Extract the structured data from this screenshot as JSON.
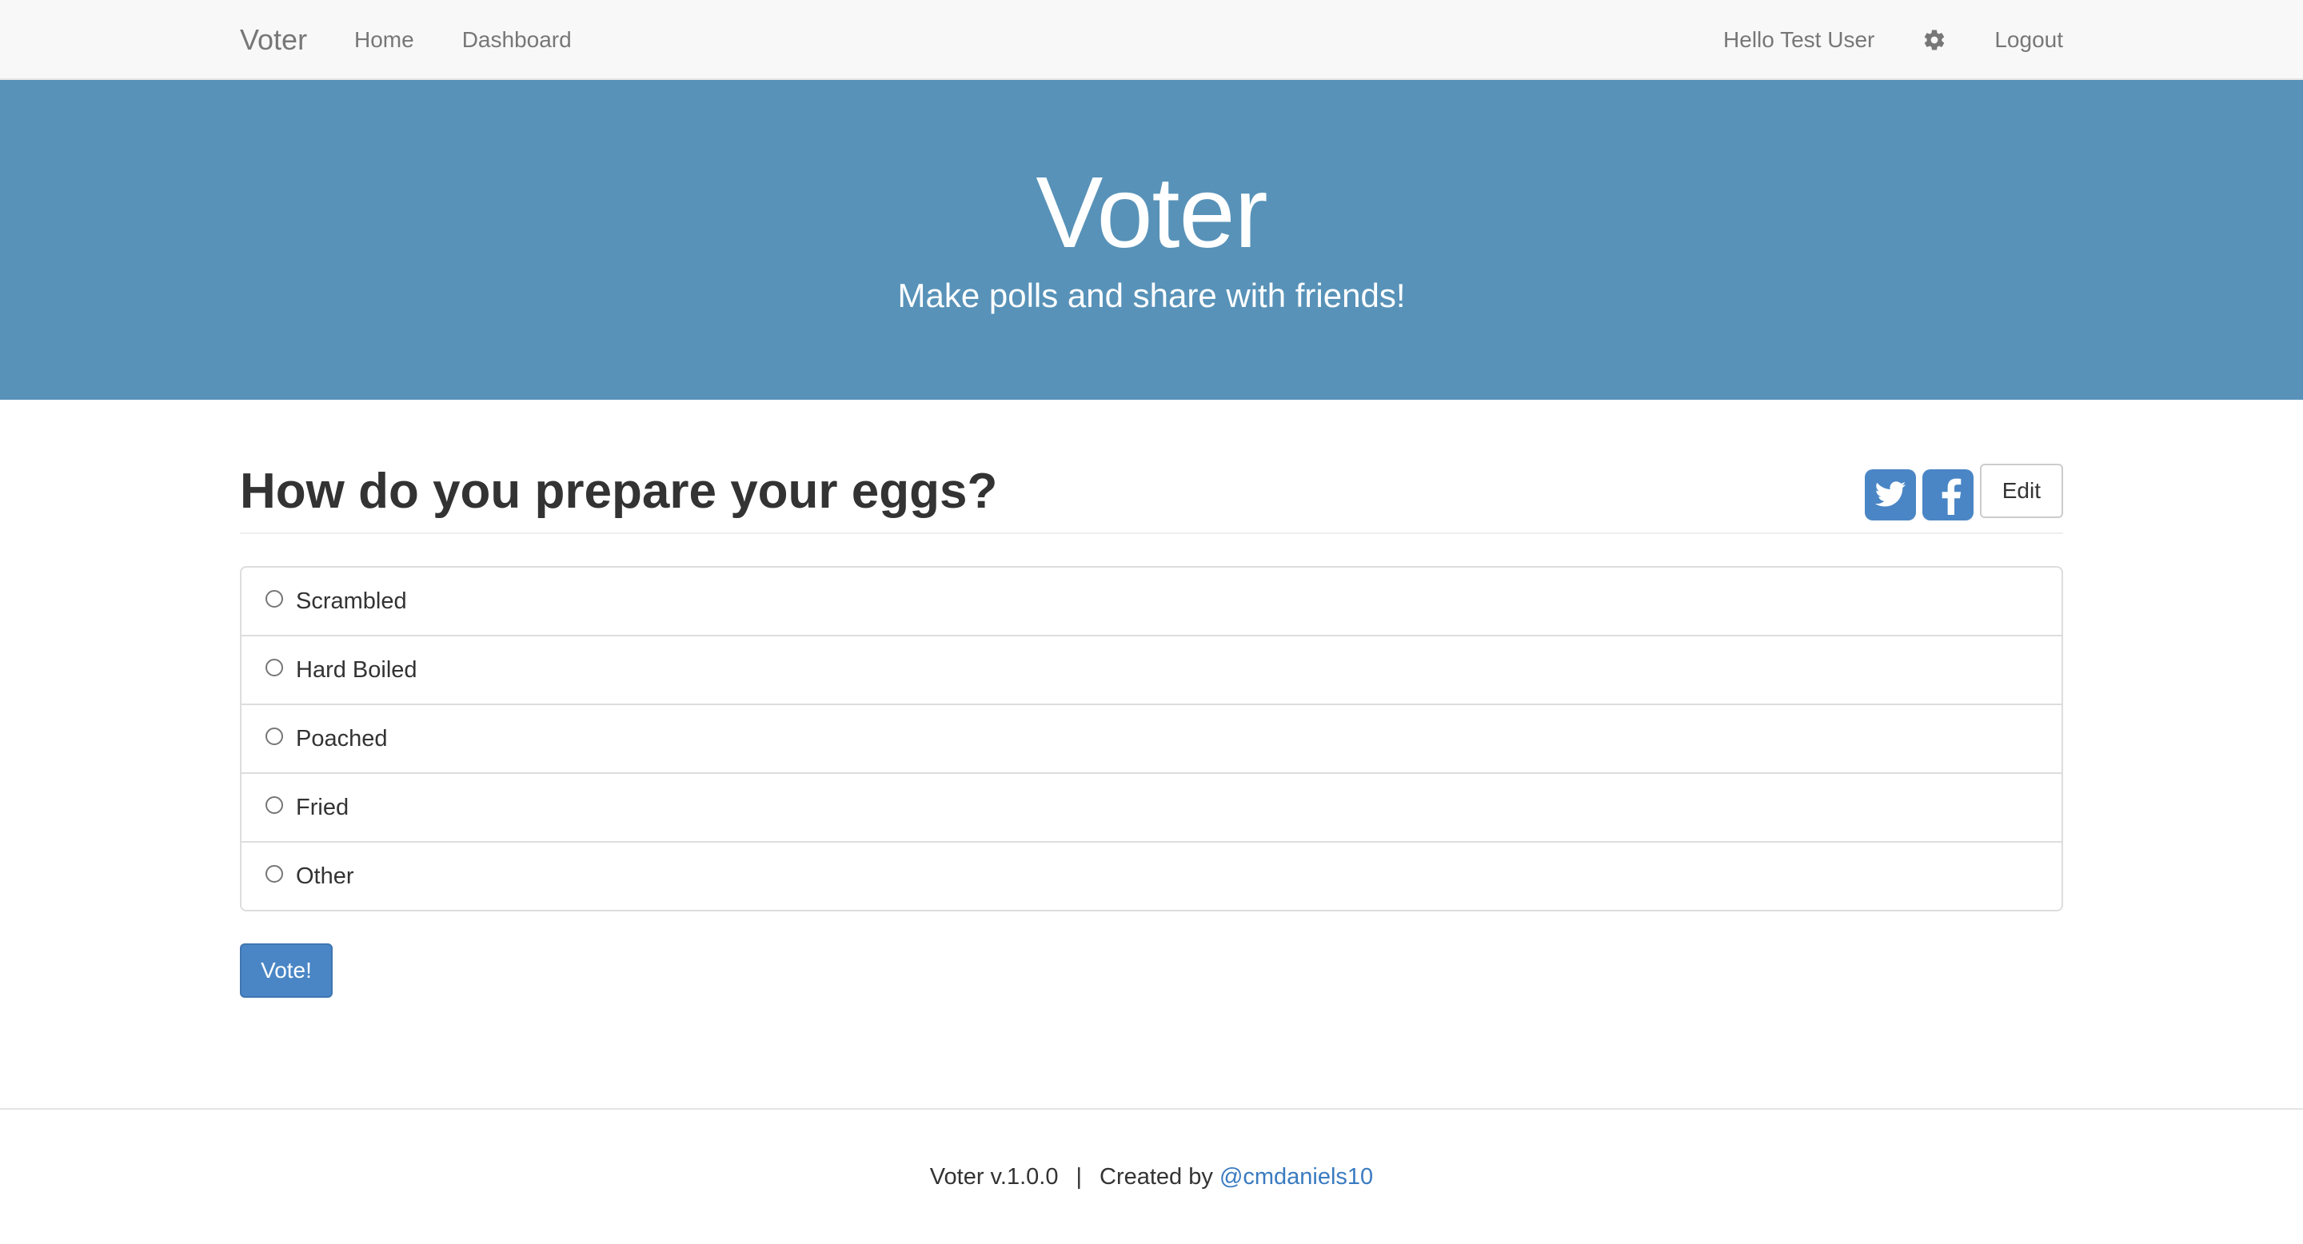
{
  "navbar": {
    "brand": "Voter",
    "links": [
      "Home",
      "Dashboard"
    ],
    "greeting": "Hello Test User",
    "settings_icon": "gear-icon",
    "logout": "Logout"
  },
  "jumbotron": {
    "title": "Voter",
    "subtitle": "Make polls and share with friends!"
  },
  "poll": {
    "question": "How do you prepare your eggs?",
    "share_icons": [
      "twitter-icon",
      "facebook-icon"
    ],
    "edit_label": "Edit",
    "options": [
      "Scrambled",
      "Hard Boiled",
      "Poached",
      "Fried",
      "Other"
    ],
    "selected": null,
    "vote_label": "Vote!"
  },
  "footer": {
    "version": "Voter v.1.0.0",
    "separator": "|",
    "created_by": "Created by",
    "author_link": "@cmdaniels10"
  },
  "colors": {
    "jumbotron_bg": "#5892b8",
    "primary": "#4a86c5",
    "link": "#3a7bc0",
    "navbar_bg": "#f8f8f8"
  }
}
